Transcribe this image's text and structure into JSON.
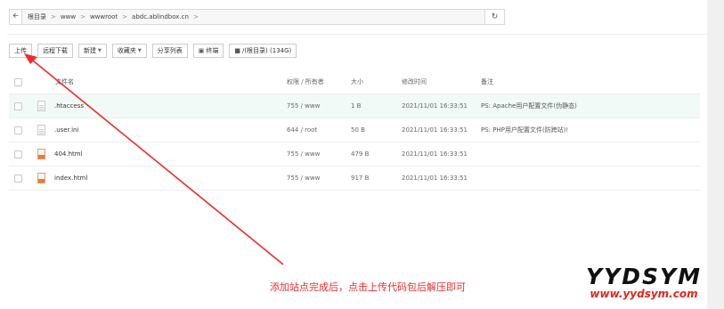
{
  "pathbar": {
    "crumbs": [
      "根目录",
      "www",
      "wwwroot",
      "abdc.ablindbox.cn"
    ]
  },
  "toolbar": {
    "upload": "上传",
    "remote_download": "远程下载",
    "new": "新建",
    "favorites": "收藏夹",
    "share_list": "分享列表",
    "terminal": "终端",
    "disk": "/(根目录) (134G)"
  },
  "table": {
    "headers": {
      "name": "文件名",
      "perm": "权限 / 所有者",
      "size": "大小",
      "time": "修改时间",
      "note": "备注"
    },
    "rows": [
      {
        "name": ".htaccess",
        "perm": "755 / www",
        "size": "1 B",
        "time": "2021/11/01 16:33:51",
        "note": "PS: Apache用户配置文件(伪静态)",
        "icon": "text-file-icon"
      },
      {
        "name": ".user.ini",
        "perm": "644 / root",
        "size": "50 B",
        "time": "2021/11/01 16:33:51",
        "note": "PS: PHP用户配置文件(防跨站)!",
        "icon": "text-file-icon"
      },
      {
        "name": "404.html",
        "perm": "755 / www",
        "size": "479 B",
        "time": "2021/11/01 16:33:51",
        "note": "",
        "icon": "html-file-icon"
      },
      {
        "name": "index.html",
        "perm": "755 / www",
        "size": "917 B",
        "time": "2021/11/01 16:33:51",
        "note": "",
        "icon": "html-file-icon"
      }
    ]
  },
  "annotation": {
    "text": "添加站点完成后，点击上传代码包后解压即可",
    "color": "#ee2b2b"
  },
  "watermark": {
    "logo": "YYDSYM",
    "url": "www.yydsym.com"
  }
}
